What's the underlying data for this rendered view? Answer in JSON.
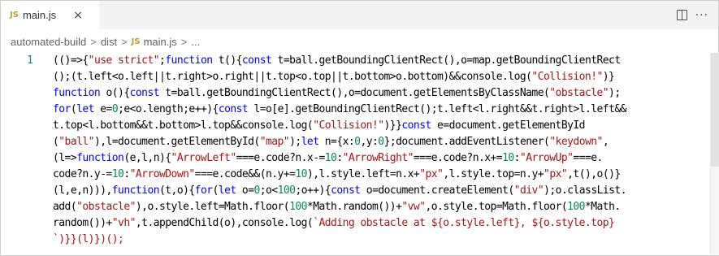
{
  "tab": {
    "lang_badge": "JS",
    "filename": "main.js",
    "close_glyph": "×"
  },
  "actions": {
    "split_icon": "split-editor-icon",
    "more_glyph": "···"
  },
  "breadcrumb": {
    "items": [
      "automated-build",
      "dist",
      "main.js",
      "..."
    ],
    "separator": ">",
    "lang_badge": "JS"
  },
  "editor": {
    "line_number": "1",
    "lines": [
      "(()=>{\"use strict\";function t(){const t=ball.getBoundingClientRect(),o=map.getBoundingClientRect",
      "();(t.left<o.left||t.right>o.right||t.top<o.top||t.bottom>o.bottom)&&console.log(\"Collision!\")}",
      "function o(){const t=ball.getBoundingClientRect(),o=document.getElementsByClassName(\"obstacle\");",
      "for(let e=0;e<o.length;e++){const l=o[e].getBoundingClientRect();t.left<l.right&&t.right>l.left&&",
      "t.top<l.bottom&&t.bottom>l.top&&console.log(\"Collision!\")}}const e=document.getElementById",
      "(\"ball\"),l=document.getElementById(\"map\");let n={x:0,y:0};document.addEventListener(\"keydown\",",
      "(l=>function(e,l,n){\"ArrowLeft\"===e.code?n.x-=10:\"ArrowRight\"===e.code?n.x+=10:\"ArrowUp\"===e.",
      "code?n.y-=10:\"ArrowDown\"===e.code&&(n.y+=10),l.style.left=n.x+\"px\",l.style.top=n.y+\"px\",t(),o()}",
      "(l,e,n))),function(t,o){for(let o=0;o<100;o++){const o=document.createElement(\"div\");o.classList.",
      "add(\"obstacle\"),o.style.left=Math.floor(100*Math.random())+\"vw\",o.style.top=Math.floor(100*Math.",
      "random())+\"vh\",t.appendChild(o),console.log(`Adding obstacle at ${o.style.left}, ${o.style.top}",
      "`)}}(l)})();"
    ]
  },
  "colors": {
    "keyword": "#0000ff",
    "string": "#a31515",
    "number": "#098658",
    "line_number": "#237893",
    "js_badge": "#b7a22c"
  }
}
